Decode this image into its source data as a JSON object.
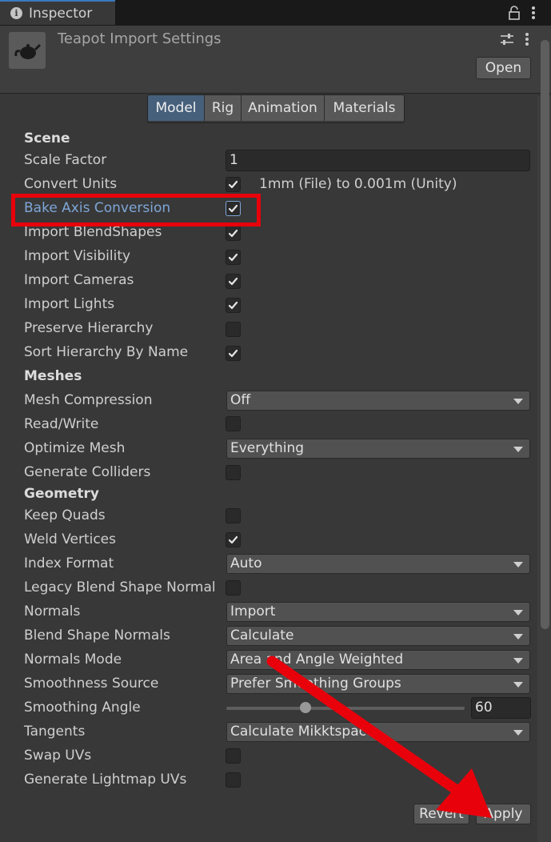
{
  "window": {
    "tab_title": "Inspector"
  },
  "header": {
    "asset_title": "Teapot Import Settings",
    "open_label": "Open"
  },
  "tabs": [
    {
      "label": "Model",
      "active": true
    },
    {
      "label": "Rig",
      "active": false
    },
    {
      "label": "Animation",
      "active": false
    },
    {
      "label": "Materials",
      "active": false
    }
  ],
  "scene": {
    "title": "Scene",
    "scale_factor": {
      "label": "Scale Factor",
      "value": "1"
    },
    "convert_units": {
      "label": "Convert Units",
      "checked": true,
      "note": "1mm (File) to 0.001m (Unity)"
    },
    "bake_axis": {
      "label": "Bake Axis Conversion",
      "checked": true
    },
    "import_blendshapes": {
      "label": "Import BlendShapes",
      "checked": true
    },
    "import_visibility": {
      "label": "Import Visibility",
      "checked": true
    },
    "import_cameras": {
      "label": "Import Cameras",
      "checked": true
    },
    "import_lights": {
      "label": "Import Lights",
      "checked": true
    },
    "preserve_hierarchy": {
      "label": "Preserve Hierarchy",
      "checked": false
    },
    "sort_hierarchy": {
      "label": "Sort Hierarchy By Name",
      "checked": true
    }
  },
  "meshes": {
    "title": "Meshes",
    "mesh_compression": {
      "label": "Mesh Compression",
      "value": "Off"
    },
    "read_write": {
      "label": "Read/Write",
      "checked": false
    },
    "optimize_mesh": {
      "label": "Optimize Mesh",
      "value": "Everything"
    },
    "generate_colliders": {
      "label": "Generate Colliders",
      "checked": false
    }
  },
  "geometry": {
    "title": "Geometry",
    "keep_quads": {
      "label": "Keep Quads",
      "checked": false
    },
    "weld_vertices": {
      "label": "Weld Vertices",
      "checked": true
    },
    "index_format": {
      "label": "Index Format",
      "value": "Auto"
    },
    "legacy_blend": {
      "label": "Legacy Blend Shape Normal",
      "checked": false
    },
    "normals": {
      "label": "Normals",
      "value": "Import"
    },
    "blend_shape_normals": {
      "label": "Blend Shape Normals",
      "value": "Calculate"
    },
    "normals_mode": {
      "label": "Normals Mode",
      "value": "Area and Angle Weighted"
    },
    "smoothness_source": {
      "label": "Smoothness Source",
      "value": "Prefer Smoothing Groups"
    },
    "smoothing_angle": {
      "label": "Smoothing Angle",
      "value": "60",
      "slider_fraction": 0.333
    },
    "tangents": {
      "label": "Tangents",
      "value": "Calculate Mikktspace"
    },
    "swap_uvs": {
      "label": "Swap UVs",
      "checked": false
    },
    "lightmap_uvs": {
      "label": "Generate Lightmap UVs",
      "checked": false
    }
  },
  "footer": {
    "revert_label": "Revert",
    "apply_label": "Apply"
  },
  "colors": {
    "highlight": "#e8000b",
    "accent": "#46607c",
    "focus_label": "#7ea6d6"
  }
}
